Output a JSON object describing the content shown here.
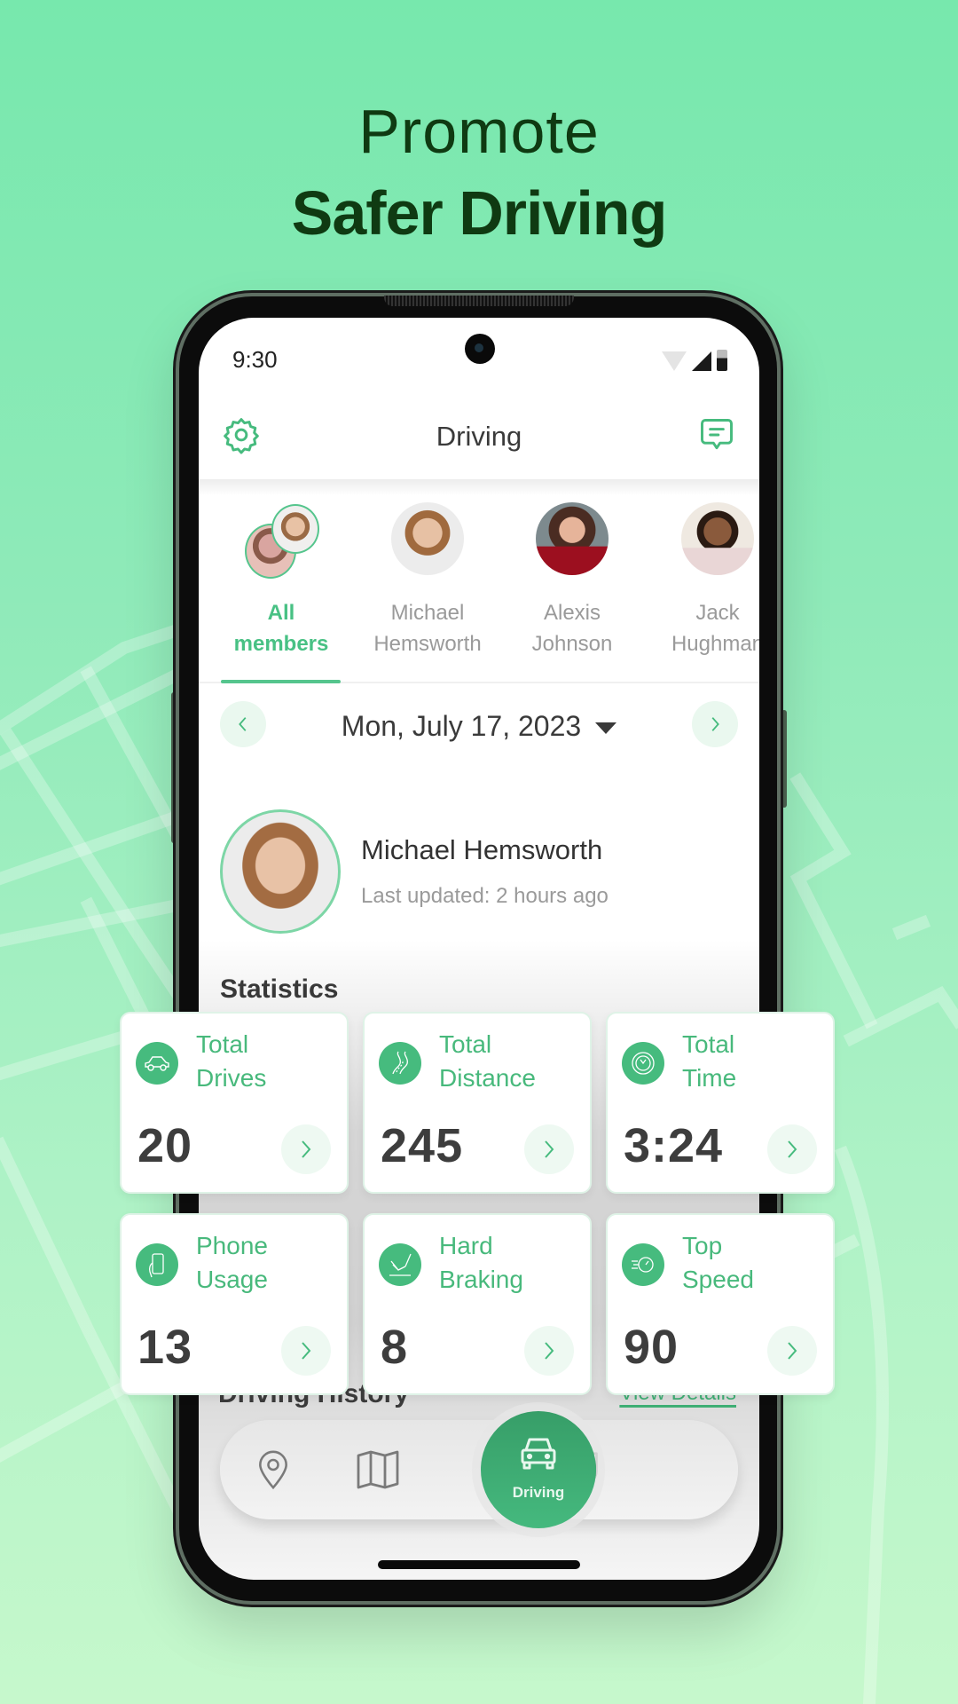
{
  "headline": {
    "line1": "Promote",
    "line2": "Safer Driving"
  },
  "status_bar": {
    "time": "9:30"
  },
  "header": {
    "title": "Driving"
  },
  "members": [
    {
      "label_line1": "All",
      "label_line2": "members",
      "active": true
    },
    {
      "label_line1": "Michael",
      "label_line2": "Hemsworth",
      "active": false
    },
    {
      "label_line1": "Alexis",
      "label_line2": "Johnson",
      "active": false
    },
    {
      "label_line1": "Jack",
      "label_line2": "Hughman",
      "active": false
    }
  ],
  "date": {
    "label": "Mon, July 17, 2023"
  },
  "profile": {
    "name": "Michael Hemsworth",
    "updated": "Last updated: 2 hours ago"
  },
  "statistics": {
    "title": "Statistics",
    "cards": [
      {
        "label_line1": "Total",
        "label_line2": "Drives",
        "value": "20",
        "icon": "car-icon"
      },
      {
        "label_line1": "Total",
        "label_line2": "Distance",
        "value": "245",
        "icon": "road-icon"
      },
      {
        "label_line1": "Total",
        "label_line2": "Time",
        "value": "3:24",
        "icon": "clock-icon"
      },
      {
        "label_line1": "Phone",
        "label_line2": "Usage",
        "value": "13",
        "icon": "phone-hand-icon"
      },
      {
        "label_line1": "Hard",
        "label_line2": "Braking",
        "value": "8",
        "icon": "brake-pedal-icon"
      },
      {
        "label_line1": "Top",
        "label_line2": "Speed",
        "value": "90",
        "icon": "speedometer-icon"
      }
    ]
  },
  "history": {
    "title": "Driving History",
    "view_details": "View Details"
  },
  "bottom_nav": {
    "items": [
      {
        "icon": "location-pin-icon"
      },
      {
        "icon": "map-icon"
      },
      {
        "icon": "car-icon",
        "label": "Driving",
        "active": true
      },
      {
        "icon": "shield-icon"
      }
    ]
  },
  "colors": {
    "accent": "#46bb7e",
    "accent_light": "#eef9f2",
    "headline": "#0f3a12",
    "background": "#8feab9"
  }
}
